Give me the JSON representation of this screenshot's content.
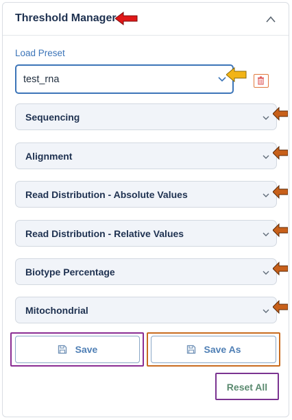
{
  "header": {
    "title": "Threshold Manager",
    "collapse_icon": "chevron-up-icon"
  },
  "preset": {
    "label": "Load Preset",
    "selected": "test_rna",
    "delete_icon": "trash-icon"
  },
  "sections": [
    {
      "label": "Sequencing"
    },
    {
      "label": "Alignment"
    },
    {
      "label": "Read Distribution - Absolute Values"
    },
    {
      "label": "Read Distribution - Relative Values"
    },
    {
      "label": "Biotype Percentage"
    },
    {
      "label": "Mitochondrial"
    }
  ],
  "actions": {
    "save_label": "Save",
    "save_as_label": "Save As",
    "reset_label": "Reset All",
    "save_icon": "floppy-disk-icon"
  },
  "annotation_colors": {
    "title_arrow": "#e01818",
    "select_arrow": "#f2b417",
    "section_arrow": "#c8601a",
    "save_box": "#8a2c92",
    "save_as_box": "#c86b1e",
    "reset_box": "#7a3390"
  }
}
